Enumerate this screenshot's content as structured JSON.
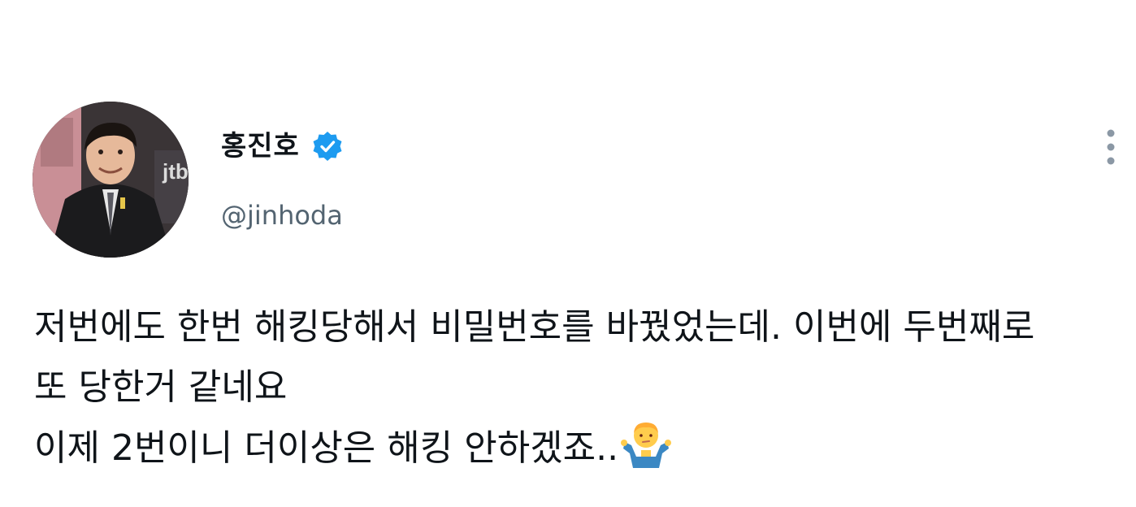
{
  "tweet": {
    "author": {
      "display_name": "홍진호",
      "handle": "@jinhoda",
      "verified": true,
      "avatar_icon": "user-avatar-photo",
      "verified_icon": "verified-badge-icon"
    },
    "more_icon": "more-vertical-icon",
    "text_lines": [
      "저번에도 한번 해킹당해서 비밀번호를 바꿨었는데. 이번에 두번째로",
      "또 당한거 같네요",
      "이제 2번이니 더이상은 해킹 안하겠죠.."
    ],
    "emoji": "shrug-emoji-icon",
    "colors": {
      "verified_blue": "#1d9bf0",
      "handle_gray": "#536471",
      "text": "#0f1419",
      "more_gray": "#8b98a5"
    }
  }
}
